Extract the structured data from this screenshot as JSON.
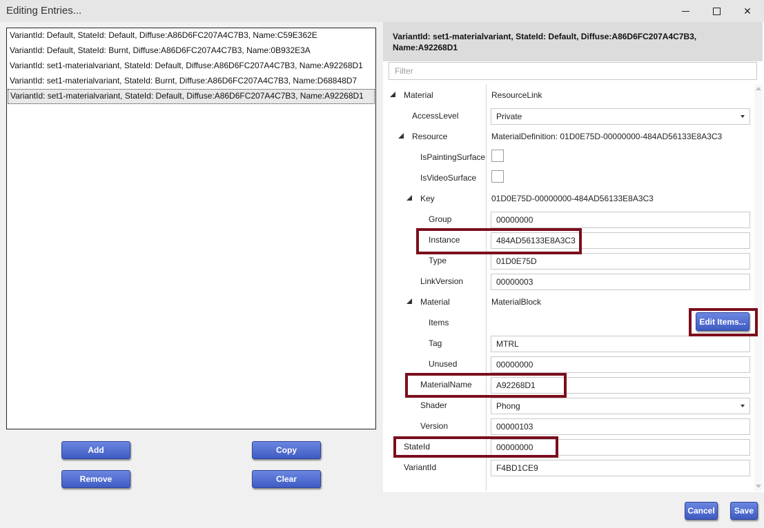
{
  "window": {
    "title": "Editing Entries...",
    "controls": {
      "minimize": "minimize",
      "maximize": "maximize",
      "close": "✕"
    }
  },
  "entries": [
    {
      "text": "VariantId: Default, StateId: Default, Diffuse:A86D6FC207A4C7B3, Name:C59E362E",
      "selected": false
    },
    {
      "text": "VariantId: Default, StateId: Burnt, Diffuse:A86D6FC207A4C7B3, Name:0B932E3A",
      "selected": false
    },
    {
      "text": "VariantId: set1-materialvariant, StateId: Default, Diffuse:A86D6FC207A4C7B3, Name:A92268D1",
      "selected": false
    },
    {
      "text": "VariantId: set1-materialvariant, StateId: Burnt, Diffuse:A86D6FC207A4C7B3, Name:D68848D7",
      "selected": false
    },
    {
      "text": "VariantId: set1-materialvariant, StateId: Default, Diffuse:A86D6FC207A4C7B3, Name:A92268D1",
      "selected": true
    }
  ],
  "buttons": {
    "add": "Add",
    "copy": "Copy",
    "remove": "Remove",
    "clear": "Clear",
    "cancel": "Cancel",
    "save": "Save",
    "edit_items": "Edit Items..."
  },
  "detail": {
    "header": "VariantId: set1-materialvariant, StateId: Default, Diffuse:A86D6FC207A4C7B3, Name:A92268D1",
    "filter_placeholder": "Filter"
  },
  "properties": {
    "material": {
      "label": "Material",
      "value": "ResourceLink"
    },
    "access_level": {
      "label": "AccessLevel",
      "value": "Private"
    },
    "resource": {
      "label": "Resource",
      "value": "MaterialDefinition: 01D0E75D-00000000-484AD56133E8A3C3"
    },
    "is_painting_surface": {
      "label": "IsPaintingSurface",
      "checked": false
    },
    "is_video_surface": {
      "label": "IsVideoSurface",
      "checked": false
    },
    "key": {
      "label": "Key",
      "value": "01D0E75D-00000000-484AD56133E8A3C3"
    },
    "group": {
      "label": "Group",
      "value": "00000000"
    },
    "instance": {
      "label": "Instance",
      "value": "484AD56133E8A3C3"
    },
    "type": {
      "label": "Type",
      "value": "01D0E75D"
    },
    "link_version": {
      "label": "LinkVersion",
      "value": "00000003"
    },
    "material_block": {
      "label": "Material",
      "value": "MaterialBlock"
    },
    "items": {
      "label": "Items"
    },
    "tag": {
      "label": "Tag",
      "value": "MTRL"
    },
    "unused": {
      "label": "Unused",
      "value": "00000000"
    },
    "material_name": {
      "label": "MaterialName",
      "value": "A92268D1"
    },
    "shader": {
      "label": "Shader",
      "value": "Phong"
    },
    "version": {
      "label": "Version",
      "value": "00000103"
    },
    "state_id": {
      "label": "StateId",
      "value": "00000000"
    },
    "variant_id": {
      "label": "VariantId",
      "value": "F4BD1CE9"
    }
  },
  "colors": {
    "highlight": "#7b0e1c",
    "button_blue": "#4a66cc",
    "header_bg": "#dcdcdc"
  }
}
